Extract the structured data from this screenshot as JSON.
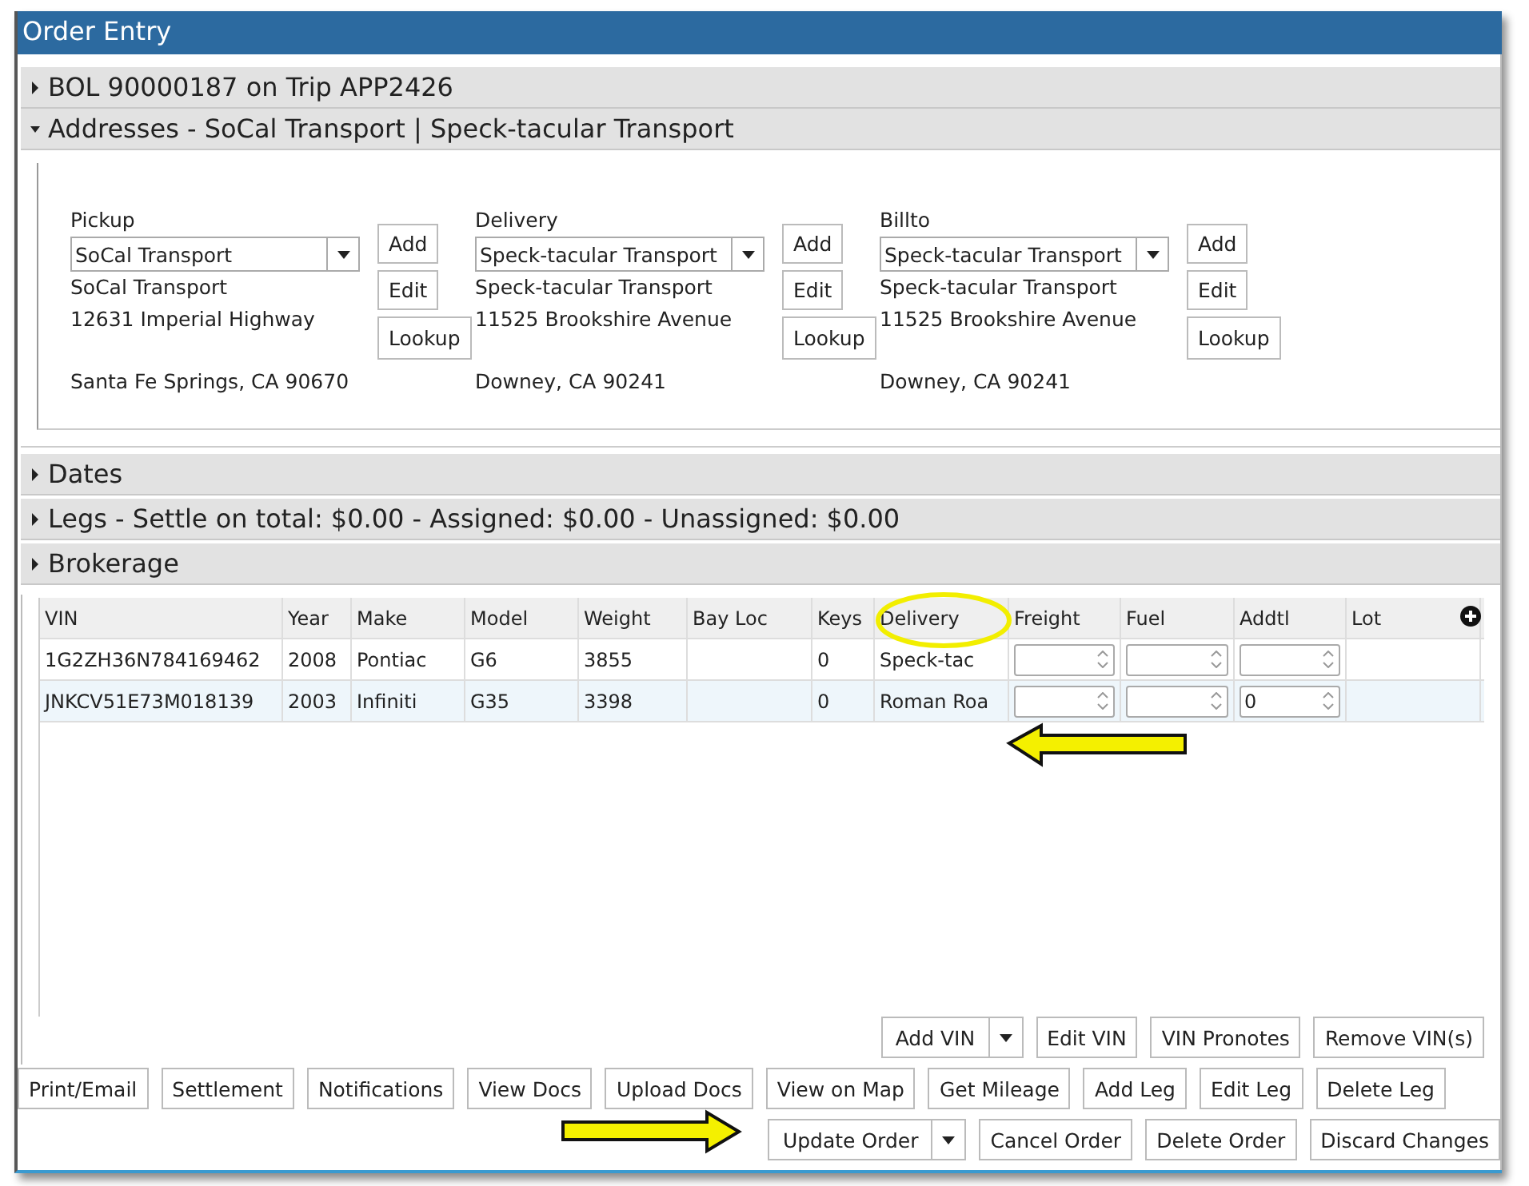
{
  "window": {
    "title": "Order Entry"
  },
  "sections": [
    {
      "title": "BOL 90000187 on Trip APP2426",
      "expanded": false
    },
    {
      "title": "Addresses - SoCal Transport | Speck-tacular Transport",
      "expanded": true
    },
    {
      "title": "Dates",
      "expanded": false
    },
    {
      "title": "Legs - Settle on total: $0.00 - Assigned: $0.00 - Unassigned: $0.00",
      "expanded": false
    },
    {
      "title": "Brokerage",
      "expanded": false
    }
  ],
  "addresses": [
    {
      "label": "Pickup",
      "value": "SoCal Transport",
      "name": "SoCal Transport",
      "street": "12631 Imperial Highway",
      "city": "Santa Fe Springs, CA 90670",
      "buttons": [
        "Add",
        "Edit",
        "Lookup"
      ]
    },
    {
      "label": "Delivery",
      "value": "Speck-tacular Transport",
      "name": "Speck-tacular Transport",
      "street": "11525 Brookshire Avenue",
      "city": "Downey, CA 90241",
      "buttons": [
        "Add",
        "Edit",
        "Lookup"
      ]
    },
    {
      "label": "Billto",
      "value": "Speck-tacular Transport",
      "name": "Speck-tacular Transport",
      "street": "11525 Brookshire Avenue",
      "city": "Downey, CA 90241",
      "buttons": [
        "Add",
        "Edit",
        "Lookup"
      ]
    }
  ],
  "table": {
    "columns": [
      {
        "label": "VIN",
        "kind": "text"
      },
      {
        "label": "Year",
        "kind": "text"
      },
      {
        "label": "Make",
        "kind": "text"
      },
      {
        "label": "Model",
        "kind": "text"
      },
      {
        "label": "Weight",
        "kind": "text"
      },
      {
        "label": "Bay Loc",
        "kind": "text"
      },
      {
        "label": "Keys",
        "kind": "text"
      },
      {
        "label": "Delivery",
        "kind": "text"
      },
      {
        "label": "Freight",
        "kind": "spin"
      },
      {
        "label": "Fuel",
        "kind": "spin"
      },
      {
        "label": "Addtl",
        "kind": "spin"
      },
      {
        "label": "Lot",
        "kind": "text"
      }
    ],
    "rows": [
      {
        "selected": false,
        "cells": [
          "1G2ZH36N784169462",
          "2008",
          "Pontiac",
          "G6",
          "3855",
          "",
          "0",
          "Speck-tac",
          "",
          "",
          "",
          ""
        ]
      },
      {
        "selected": true,
        "cells": [
          "JNKCV51E73M018139",
          "2003",
          "Infiniti",
          "G35",
          "3398",
          "",
          "0",
          "Roman Roa",
          "",
          "",
          "0",
          ""
        ]
      }
    ]
  },
  "vin_buttons": [
    {
      "label": "Add VIN",
      "kind": "split"
    },
    {
      "label": "Edit VIN",
      "kind": "plain"
    },
    {
      "label": "VIN Pronotes",
      "kind": "plain"
    },
    {
      "label": "Remove VIN(s)",
      "kind": "plain"
    }
  ],
  "action_buttons": [
    {
      "label": "Print/Email",
      "kind": "plain"
    },
    {
      "label": "Settlement",
      "kind": "plain"
    },
    {
      "label": "Notifications",
      "kind": "plain"
    },
    {
      "label": "View Docs",
      "kind": "plain"
    },
    {
      "label": "Upload Docs",
      "kind": "plain"
    },
    {
      "label": "View on Map",
      "kind": "plain"
    },
    {
      "label": "Get Mileage",
      "kind": "plain"
    },
    {
      "label": "Add Leg",
      "kind": "plain"
    },
    {
      "label": "Edit Leg",
      "kind": "plain"
    },
    {
      "label": "Delete Leg",
      "kind": "plain"
    }
  ],
  "order_buttons": [
    {
      "label": "Update Order",
      "kind": "split"
    },
    {
      "label": "Cancel Order",
      "kind": "plain"
    },
    {
      "label": "Delete Order",
      "kind": "plain"
    },
    {
      "label": "Discard Changes",
      "kind": "plain"
    }
  ]
}
